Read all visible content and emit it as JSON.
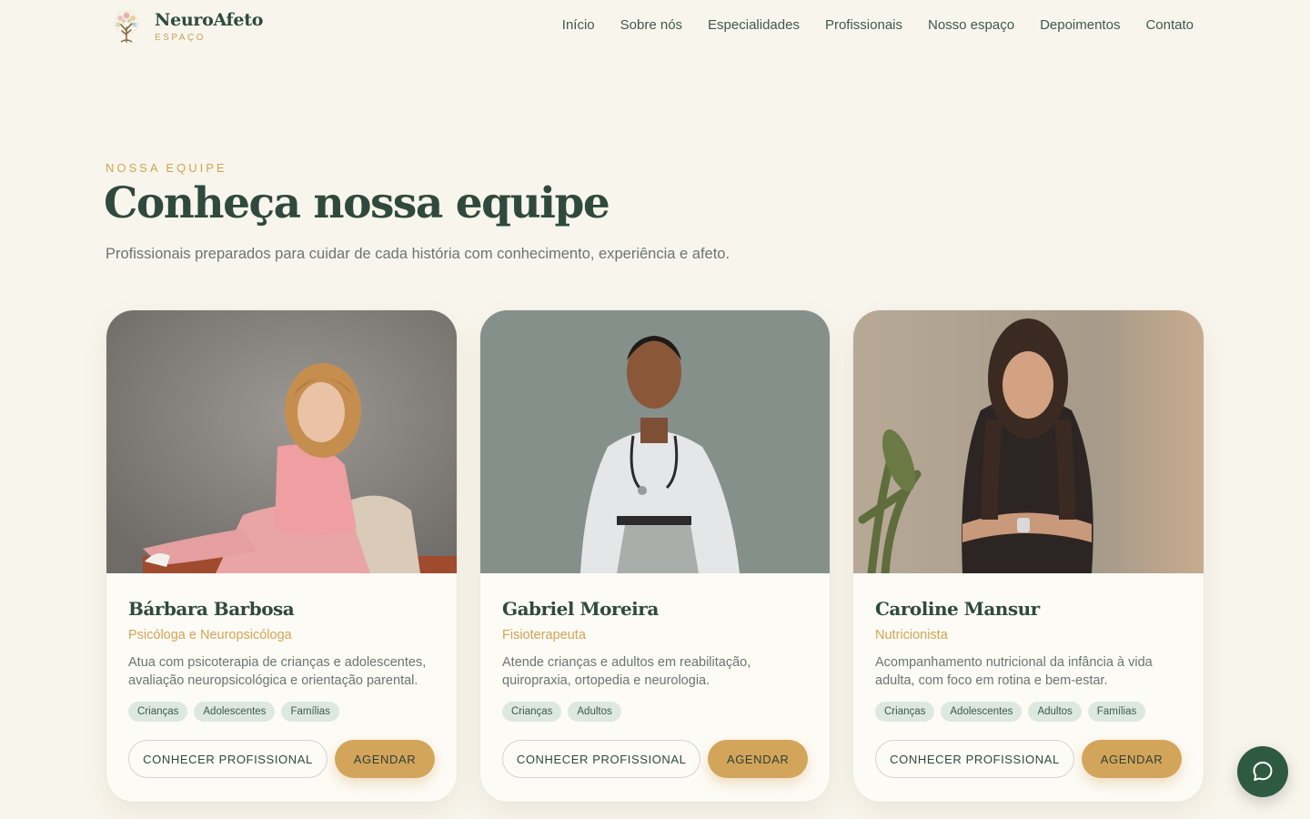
{
  "brand": {
    "name": "NeuroAfeto",
    "sub": "ESPAÇO",
    "colors": {
      "primary": "#2f4a3c",
      "accent": "#d3a453",
      "background": "#f8f5ec",
      "tag_bg": "#dde9e0"
    }
  },
  "nav": {
    "items": [
      "Início",
      "Sobre nós",
      "Especialidades",
      "Profissionais",
      "Nosso espaço",
      "Depoimentos",
      "Contato"
    ]
  },
  "section": {
    "eyebrow": "NOSSA EQUIPE",
    "title": "Conheça nossa equipe",
    "subtitle": "Profissionais preparados para cuidar de cada história com conhecimento, experiência e afeto."
  },
  "cards": [
    {
      "name": "Bárbara Barbosa",
      "role": "Psicóloga e Neuropsicóloga",
      "description": "Atua com psicoterapia de crianças e adolescentes, avaliação neuropsicológica e orientação parental.",
      "tags": [
        "Crianças",
        "Adolescentes",
        "Famílias"
      ],
      "primary_action": "CONHECER PROFISSIONAL",
      "secondary_action": "AGENDAR"
    },
    {
      "name": "Gabriel Moreira",
      "role": "Fisioterapeuta",
      "description": "Atende crianças e adultos em reabilitação, quiropraxia, ortopedia e neurologia.",
      "tags": [
        "Crianças",
        "Adultos"
      ],
      "primary_action": "CONHECER PROFISSIONAL",
      "secondary_action": "AGENDAR"
    },
    {
      "name": "Caroline Mansur",
      "role": "Nutricionista",
      "description": "Acompanhamento nutricional da infância à vida adulta, com foco em rotina e bem-estar.",
      "tags": [
        "Crianças",
        "Adolescentes",
        "Adultos",
        "Famílias"
      ],
      "primary_action": "CONHECER PROFISSIONAL",
      "secondary_action": "AGENDAR"
    }
  ],
  "chat": {
    "icon": "chat-bubble-icon"
  }
}
